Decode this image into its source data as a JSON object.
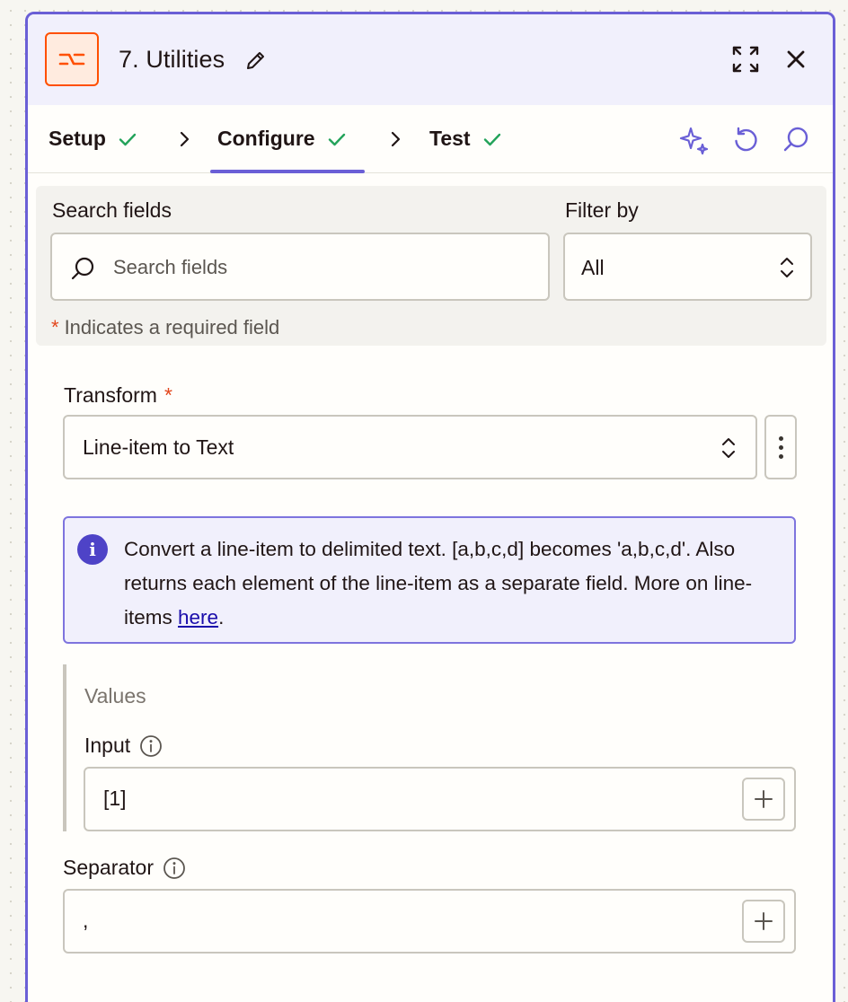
{
  "header": {
    "title": "7. Utilities",
    "icons": {
      "app": "utilities-icon",
      "edit": "pencil-icon",
      "expand": "expand-icon",
      "close": "close-icon"
    }
  },
  "tabs": [
    {
      "label": "Setup",
      "complete": true
    },
    {
      "label": "Configure",
      "complete": true,
      "active": true
    },
    {
      "label": "Test",
      "complete": true
    }
  ],
  "toolbar": {
    "icons": [
      "ai-sparkle-icon",
      "undo-icon",
      "search-icon"
    ]
  },
  "search": {
    "label": "Search fields",
    "placeholder": "Search fields",
    "filter_label": "Filter by",
    "filter_value": "All",
    "required_note": "Indicates a required field",
    "required_marker": "*"
  },
  "transform": {
    "label": "Transform",
    "required_marker": "*",
    "value": "Line-item to Text"
  },
  "info": {
    "text": "Convert a line-item to delimited text. [a,b,c,d] becomes 'a,b,c,d'. Also returns each element of the line-item as a separate field. More on line-items ",
    "link_text": "here",
    "suffix": "."
  },
  "values": {
    "group_label": "Values",
    "input_label": "Input",
    "input_value": "[1]"
  },
  "separator": {
    "label": "Separator",
    "value": ","
  },
  "colors": {
    "accent": "#6a5fd6",
    "brand_orange": "#ff4f00",
    "check_green": "#23a35a",
    "required_red": "#e3461c"
  }
}
